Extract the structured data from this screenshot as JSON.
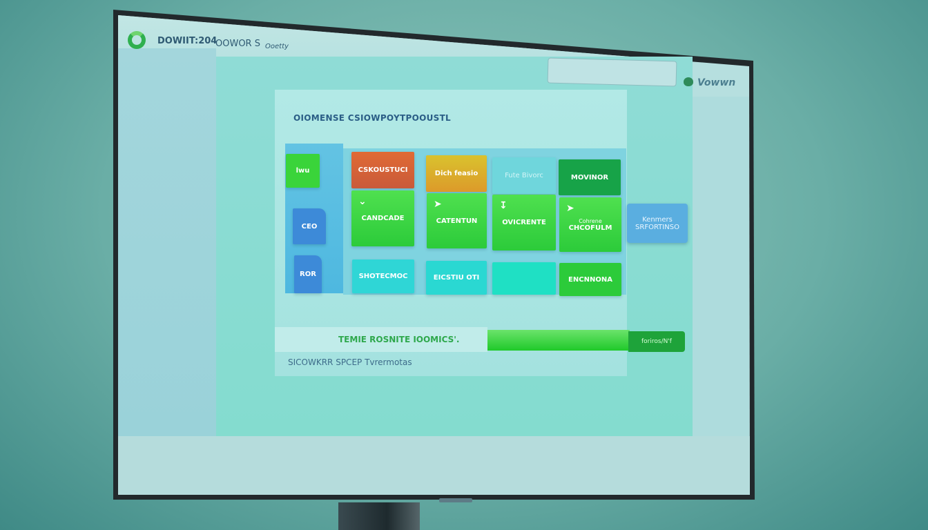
{
  "header": {
    "app_name": "DOWIIT:204",
    "nav_1": "OOWOR S",
    "nav_2": "Ooetty",
    "user_name": "Vowwn",
    "search_placeholder": ""
  },
  "card": {
    "title": "OIOMENSE CSIOWPOYTPOOUSTL",
    "row_labels": [
      "lwu",
      "CEO",
      "ROR"
    ],
    "columns": [
      {
        "top": "CSKOUSTUCI",
        "middle": "CANDCADE",
        "bottom": "SHOTECMOC",
        "top_color": "#d96a3a"
      },
      {
        "top": "Dich feasio",
        "middle": "CATENTUN",
        "bottom": "EICSTIU OTI",
        "top_color": "#dcaa2a"
      },
      {
        "top": "Fute Bivorc",
        "middle": "OVICRENTE",
        "bottom": "",
        "top_color": "#6fd6dc"
      },
      {
        "top": "MOVINOR",
        "middle_small": "Cohrene",
        "middle": "CHCOFULM",
        "bottom": "ENCNNONA",
        "top_color": "#17a348"
      }
    ],
    "side_button": {
      "line1": "Kenmers",
      "line2": "SRFORTINSO"
    },
    "progress": {
      "label": "TEMIE ROSNITE IOOMICS'.",
      "end_label": "foriros/N'f",
      "value_fraction": 0.48
    },
    "footnote": "SICOWKRR SPCEP Tvrermotas"
  },
  "colors": {
    "accent_green": "#1fc92a",
    "tile_green": "#3ad43a",
    "tile_cyan": "#2fdcd2",
    "tile_blue": "#3d8ad8"
  }
}
